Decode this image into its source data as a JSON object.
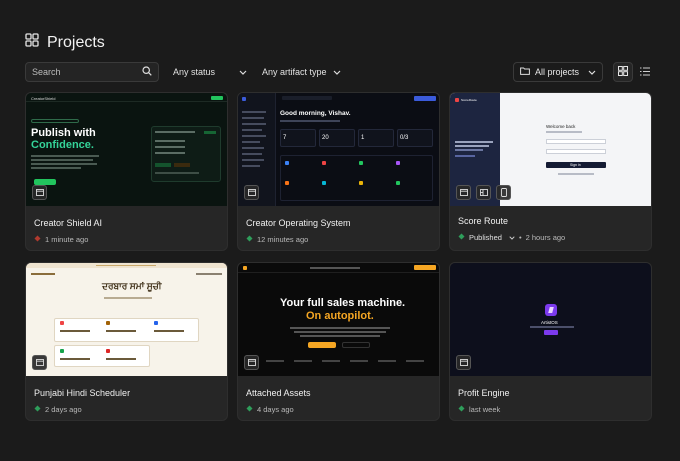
{
  "header": {
    "title": "Projects",
    "icon": "grid-icon"
  },
  "toolbar": {
    "search_placeholder": "Search",
    "status_filter": "Any status",
    "artifact_filter": "Any artifact type",
    "project_filter": "All projects",
    "views": [
      "grid-view-icon",
      "list-view-icon"
    ]
  },
  "colors": {
    "background": "#1b1b1b",
    "card": "#262626",
    "status_green": "#2e9e5b",
    "status_red": "#c0392b",
    "accent_orange": "#f5a623"
  },
  "projects": [
    {
      "name": "Creator Shield AI",
      "status": "",
      "time": "1 minute ago",
      "status_color": "#c0392b",
      "thumb": {
        "brand": "CreatorShield",
        "headline_1": "Publish with",
        "headline_2": "Confidence."
      }
    },
    {
      "name": "Creator Operating System",
      "status": "",
      "time": "12 minutes ago",
      "status_color": "#2e9e5b",
      "thumb": {
        "greeting": "Good morning, Vishav.",
        "stats": [
          "7",
          "20",
          "1",
          "0/3"
        ]
      }
    },
    {
      "name": "Score Route",
      "status": "Published",
      "time": "2 hours ago",
      "status_color": "#2e9e5b",
      "thumb": {
        "brand": "ScoreRoute",
        "welcome": "Welcome back",
        "signin": "Sign in"
      }
    },
    {
      "name": "Punjabi Hindi Scheduler",
      "status": "",
      "time": "2 days ago",
      "status_color": "#2e9e5b",
      "thumb": {
        "headline": "ਦਰਬਾਰ ਸਮਾਂ ਸੂਚੀ"
      }
    },
    {
      "name": "Attached Assets",
      "status": "",
      "time": "4 days ago",
      "status_color": "#2e9e5b",
      "thumb": {
        "headline_1": "Your full sales machine.",
        "headline_2": "On autopilot."
      }
    },
    {
      "name": "Profit Engine",
      "status": "",
      "time": "last week",
      "status_color": "#2e9e5b",
      "thumb": {
        "brand": "ArtistOS"
      }
    }
  ]
}
